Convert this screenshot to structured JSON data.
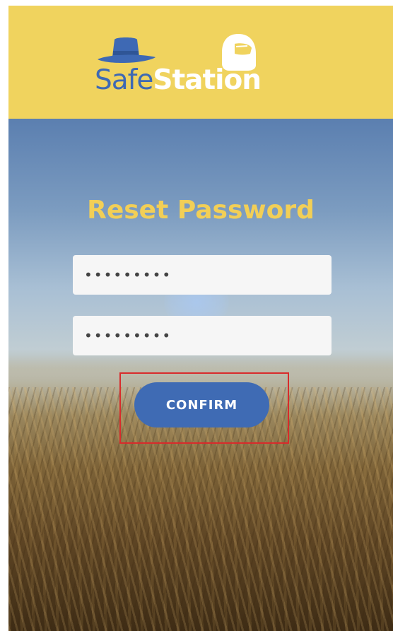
{
  "header": {
    "logo": {
      "text_left": "Safe",
      "text_right": "Station",
      "hat_icon": "hat-icon",
      "helmet_icon": "helmet-icon",
      "colors": {
        "header_bg": "#f0d35e",
        "safe_text": "#3e69b4",
        "station_text": "#ffffff"
      }
    }
  },
  "main": {
    "title": "Reset Password",
    "password_field_1": {
      "value": "•••••••••"
    },
    "password_field_2": {
      "value": "•••••••••"
    },
    "confirm_button": {
      "label": "CONFIRM",
      "color": "#3f6bb4"
    },
    "highlight_color": "#d82b2b",
    "title_color": "#f2cf56"
  }
}
